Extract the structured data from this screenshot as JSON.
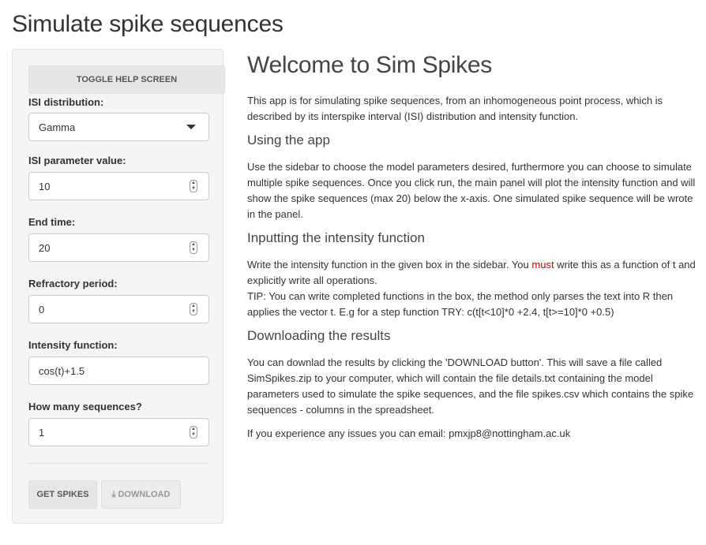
{
  "app": {
    "title": "Simulate spike sequences"
  },
  "sidebar": {
    "toggle_label": "TOGGLE HELP SCREEN",
    "isi_distribution": {
      "label": "ISI distribution:",
      "value": "Gamma"
    },
    "isi_parameter": {
      "label": "ISI parameter value:",
      "value": "10"
    },
    "end_time": {
      "label": "End time:",
      "value": "20"
    },
    "refractory": {
      "label": "Refractory period:",
      "value": "0"
    },
    "intensity": {
      "label": "Intensity function:",
      "value": "cos(t)+1.5"
    },
    "sequences": {
      "label": "How many sequences?",
      "value": "1"
    },
    "get_spikes_label": "GET SPIKES",
    "download_label": "DOWNLOAD"
  },
  "main": {
    "heading": "Welcome to Sim Spikes",
    "intro": "This app is for simulating spike sequences, from an inhomogeneous point process, which is described by its interspike interval (ISI) distribution and intensity function.",
    "using_heading": "Using the app",
    "using_text": "Use the sidebar to choose the model parameters desired, furthermore you can choose to simulate multiple spike sequences. Once you click run, the main panel will plot the intensity function and will show the spike sequences (max 20) below the x-axis. One simulated spike sequence will be wrote in the panel.",
    "input_heading": "Inputting the intensity function",
    "input_text_before": "Write the intensity function in the given box in the sidebar. You ",
    "input_text_emph": "must",
    "input_text_after": " write this as a function of t and explicitly write all operations.",
    "tip_text": "TIP: You can write completed functions in the box, the method only parses the text into R then applies the vector t. E.g for a step function TRY: c(t[t<10]*0 +2.4, t[t>=10]*0 +0.5)",
    "download_heading": "Downloading the results",
    "download_text": "You can downlad the results by clicking the 'DOWNLOAD button'. This will save a file called SimSpikes.zip to your computer, which will contain the file details.txt containing the model parameters used to simulate the spike sequences, and the file spikes.csv which contains the spike sequences - columns in the spreadsheet.",
    "contact_text": "If you experience any issues you can email: pmxjp8@nottingham.ac.uk"
  }
}
